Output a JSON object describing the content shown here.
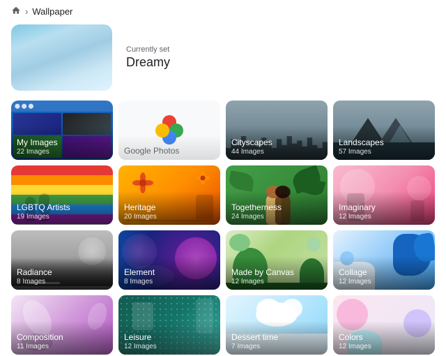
{
  "breadcrumb": {
    "home_aria": "Home",
    "separator": "›",
    "current": "Wallpaper"
  },
  "current_wallpaper": {
    "label": "Currently set",
    "name": "Dreamy"
  },
  "grid": {
    "items": [
      {
        "id": "my-images",
        "name": "My Images",
        "count": "22 Images",
        "type": "my-images"
      },
      {
        "id": "google-photos",
        "name": "Google Photos",
        "count": "",
        "type": "google-photos"
      },
      {
        "id": "cityscapes",
        "name": "Cityscapes",
        "count": "44 Images",
        "type": "cityscapes"
      },
      {
        "id": "landscapes",
        "name": "Landscapes",
        "count": "57 Images",
        "type": "landscapes"
      },
      {
        "id": "lgbtq",
        "name": "LGBTQ Artists",
        "count": "19 Images",
        "type": "lgbtq"
      },
      {
        "id": "heritage",
        "name": "Heritage",
        "count": "20 Images",
        "type": "heritage"
      },
      {
        "id": "togetherness",
        "name": "Togetherness",
        "count": "24 Images",
        "type": "togetherness"
      },
      {
        "id": "imaginary",
        "name": "Imaginary",
        "count": "12 Images",
        "type": "imaginary"
      },
      {
        "id": "radiance",
        "name": "Radiance",
        "count": "8 Images",
        "type": "radiance"
      },
      {
        "id": "element",
        "name": "Element",
        "count": "8 Images",
        "type": "element"
      },
      {
        "id": "made-by-canvas",
        "name": "Made by Canvas",
        "count": "12 Images",
        "type": "canvas"
      },
      {
        "id": "collage",
        "name": "Collage",
        "count": "12 Images",
        "type": "collage"
      },
      {
        "id": "composition",
        "name": "Composition",
        "count": "11 Images",
        "type": "composition"
      },
      {
        "id": "leisure",
        "name": "Leisure",
        "count": "12 Images",
        "type": "leisure"
      },
      {
        "id": "dessert-time",
        "name": "Dessert time",
        "count": "7 Images",
        "type": "dessert"
      },
      {
        "id": "colors",
        "name": "Colors",
        "count": "12 Images",
        "type": "colors"
      }
    ]
  }
}
